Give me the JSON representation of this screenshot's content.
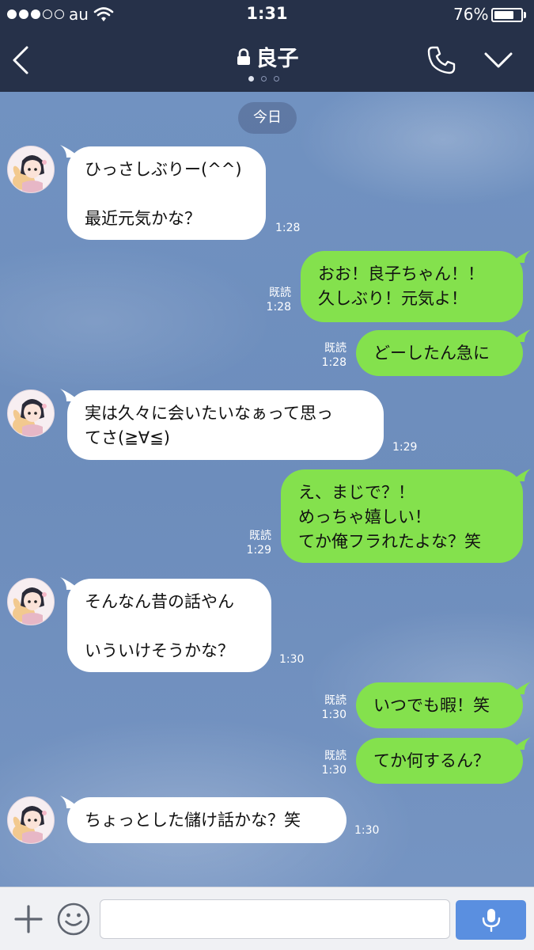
{
  "status_bar": {
    "carrier": "au",
    "time": "1:31",
    "battery_pct": "76%",
    "battery_level": 0.76,
    "signal_dots_filled": 3,
    "signal_dots_total": 5,
    "icons": [
      "signal-dots",
      "wifi-icon",
      "battery-icon"
    ]
  },
  "header": {
    "title": "良子",
    "page_indicator": {
      "count": 3,
      "active": 0
    },
    "icons": [
      "back-chevron-icon",
      "lock-icon",
      "phone-icon",
      "chevron-down-icon"
    ]
  },
  "chat": {
    "date_separator": "今日",
    "messages": [
      {
        "side": "left",
        "text": "ひっさしぶりー(^^)\n\n最近元気かな？",
        "time": "1:28"
      },
      {
        "side": "right",
        "text": "おお！良子ちゃん！！\n久しぶり！元気よ！",
        "read": "既読",
        "time": "1:28"
      },
      {
        "side": "right",
        "text": "どーしたん急に",
        "read": "既読",
        "time": "1:28"
      },
      {
        "side": "left",
        "text": "実は久々に会いたいなぁって思っ\nてさ(≧∀≦)",
        "time": "1:29"
      },
      {
        "side": "right",
        "text": "え、まじで？！\nめっちゃ嬉しい！\nてか俺フラれたよな？笑",
        "read": "既読",
        "time": "1:29"
      },
      {
        "side": "left",
        "text": "そんなん昔の話やん\n\nいういけそうかな？",
        "time": "1:30"
      },
      {
        "side": "right",
        "text": "いつでも暇！笑",
        "read": "既読",
        "time": "1:30"
      },
      {
        "side": "right",
        "text": "てか何するん？",
        "read": "既読",
        "time": "1:30"
      },
      {
        "side": "left",
        "text": "ちょっとした儲け話かな？笑",
        "time": "1:30"
      }
    ]
  },
  "input_bar": {
    "placeholder": "",
    "value": "",
    "icons": [
      "plus-icon",
      "emoji-icon",
      "microphone-icon"
    ]
  },
  "colors": {
    "header_bg": "#263149",
    "chat_bg": "#7192c1",
    "bubble_right": "#84e14d",
    "bubble_left": "#ffffff",
    "mic_button": "#5a8fe0"
  }
}
